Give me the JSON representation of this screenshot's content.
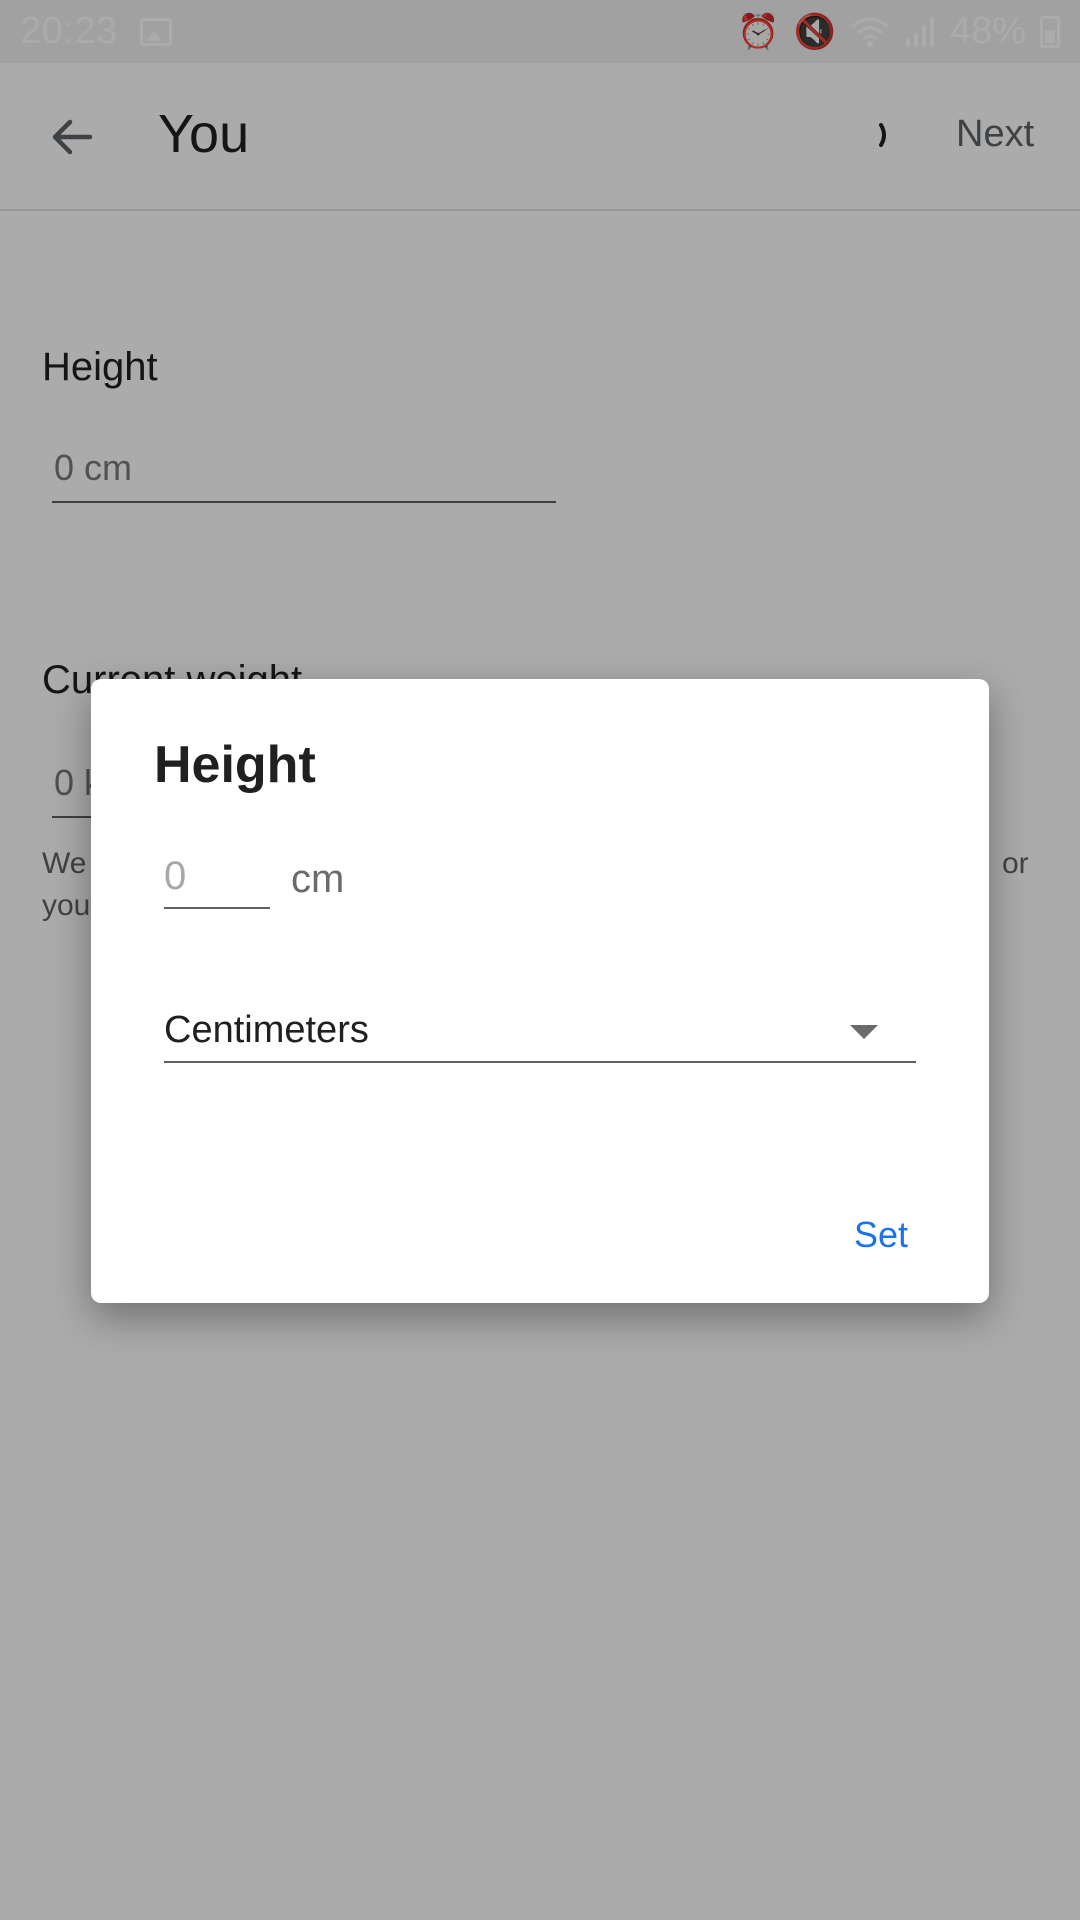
{
  "status_bar": {
    "time": "20:23",
    "battery": "48%",
    "icons": [
      "image-icon",
      "alarm-icon",
      "mute-icon",
      "wifi-icon",
      "signal-icon",
      "battery-icon"
    ]
  },
  "app_bar": {
    "title": "You",
    "next_label": "Next"
  },
  "form": {
    "height_label": "Height",
    "height_value": "0 cm",
    "weight_label": "Current weight",
    "weight_value": "0 kg",
    "note_line1": "We",
    "note_line1_end": "or",
    "note_line2": "you"
  },
  "dialog": {
    "title": "Height",
    "input_placeholder": "0",
    "unit": "cm",
    "unit_selected": "Centimeters",
    "set_label": "Set"
  },
  "colors": {
    "accent": "#1a73e8",
    "scrim": "#000000"
  }
}
